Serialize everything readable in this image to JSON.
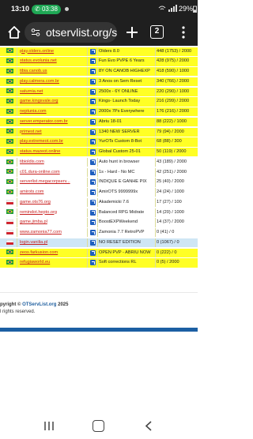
{
  "status_bar": {
    "time": "13:10",
    "call_duration": "03:38",
    "battery": "29%"
  },
  "browser": {
    "url": "otservlist.org/se",
    "tab_count": "2"
  },
  "servers": [
    {
      "flag": "br",
      "name": "play.olders.online",
      "title": "Olders 8.0",
      "players": "448 (1753) / 2000",
      "row": "yellow"
    },
    {
      "flag": "br",
      "name": "status.evolunia.net",
      "title": "Fun Evo PVPE 6 Years",
      "players": "428 (975) / 2000",
      "row": "yellow"
    },
    {
      "flag": "br",
      "name": "tibia.canob.us",
      "title": "8Y ON CANOB HIGHEXP",
      "players": "418 (590) / 1000",
      "row": "yellow"
    },
    {
      "flag": "br",
      "name": "play.calmera.com.br",
      "title": "3 Anos on Sem Reset",
      "players": "340 (766) / 2000",
      "row": "yellow"
    },
    {
      "flag": "br",
      "name": "saturnia.net",
      "title": "2500x - 6Y ONLINE",
      "players": "220 (290) / 1000",
      "row": "yellow"
    },
    {
      "flag": "br",
      "name": "game.kingsvale.org",
      "title": "Kings- Launch Today",
      "players": "216 (299) / 2000",
      "row": "yellow"
    },
    {
      "flag": "br",
      "name": "neptunia.com",
      "title": "2000x 7Ps Everywhere",
      "players": "176 (216) / 2000",
      "row": "yellow"
    },
    {
      "flag": "br",
      "name": "server.emperator.com.br",
      "title": "Abriu 18-01",
      "players": "88 (222) / 1000",
      "row": "yellow"
    },
    {
      "flag": "br",
      "name": "primest.net",
      "title": "1340 NEW SERVER",
      "players": "79 (94) / 2000",
      "row": "yellow"
    },
    {
      "flag": "br",
      "name": "play.extremeot.com.br",
      "title": "YurOTs Custom 8-Bot",
      "players": "68 (88) / 300",
      "row": "yellow"
    },
    {
      "flag": "br",
      "name": "status.mazeot.online",
      "title": "Global Custom 25-01",
      "players": "50 (119) / 2000",
      "row": "yellow"
    },
    {
      "flag": "br",
      "name": "tibioldis.com",
      "title": "Auto hunt in browser",
      "players": "43 (189) / 2000",
      "row": "white"
    },
    {
      "flag": "br",
      "name": "c01.dura-online.com",
      "title": "1s - Hard - No MC",
      "players": "42 (251) / 2000",
      "row": "white"
    },
    {
      "flag": "br",
      "name": "serverlist.megacorpserv...",
      "title": "INDIQUE E GANHE PIX",
      "players": "25 (40) / 2000",
      "row": "white"
    },
    {
      "flag": "br",
      "name": "amirots.com",
      "title": "AmirOTS 9999999x",
      "players": "24 (24) / 1000",
      "row": "white"
    },
    {
      "flag": "pl",
      "name": "game.ots76.org",
      "title": "Akademicki 7.6",
      "players": "17 (27) / 100",
      "row": "white"
    },
    {
      "flag": "br",
      "name": "remindot.hepto.org",
      "title": "Balanced RPG Midrate",
      "players": "14 (20) / 1000",
      "row": "white"
    },
    {
      "flag": "pl",
      "name": "game.jimba.pl",
      "title": "BoostEXPWeekend",
      "players": "14 (37) / 2000",
      "row": "white"
    },
    {
      "flag": "pl",
      "name": "www.zamonia77.com",
      "title": "Zamonia 7.7 RetroPVP",
      "players": "0 (41) / 0",
      "row": "white"
    },
    {
      "flag": "pl",
      "name": "login.vanilia.pl",
      "title": "NO RESET EDITION",
      "players": "0 (1067) / 0",
      "row": "selected"
    },
    {
      "flag": "br",
      "name": "zeos.farkusion.com",
      "title": "OPEN PVP - ABRIU NOW",
      "players": "0 (222) / 0",
      "row": "yellow"
    },
    {
      "flag": "br",
      "name": "refugiaworld.eu",
      "title": "Soft corrections RL",
      "players": "0 (5) / 2000",
      "row": "yellow"
    }
  ],
  "footer": {
    "copyright_prefix": "pyright © ",
    "brand": "OTServList.org",
    "copyright_suffix": " 2025",
    "rights": "l rights reserved."
  },
  "colors": {
    "row_yellow": "#ffff25",
    "row_selected": "#cfe6f5",
    "link_red": "#c81e1e",
    "footer_bar": "#1c5fa3",
    "browser_bg": "#1f1f1f"
  }
}
